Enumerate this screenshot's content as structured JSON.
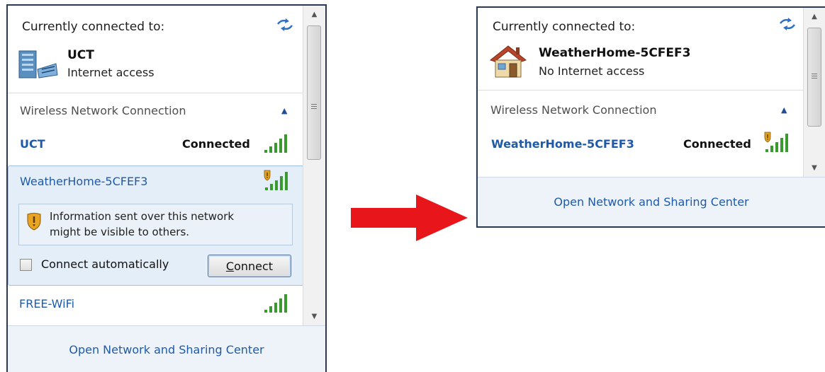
{
  "before": {
    "heading": "Currently connected to:",
    "current": {
      "name": "UCT",
      "status": "Internet access",
      "icon": "network-building-icon"
    },
    "section_title": "Wireless Network Connection",
    "networks": [
      {
        "name": "UCT",
        "state": "Connected",
        "secured": true
      },
      {
        "name": "WeatherHome-5CFEF3",
        "state": "",
        "secured": false
      },
      {
        "name": "FREE-WiFi",
        "state": "",
        "secured": false
      }
    ],
    "warning": {
      "line1": "Information sent over this network",
      "line2": "might be visible to others."
    },
    "connect_auto_label": "Connect automatically",
    "connect_auto_checked": false,
    "connect_button": {
      "accel": "C",
      "rest": "onnect"
    },
    "footer_link": "Open Network and Sharing Center"
  },
  "after": {
    "heading": "Currently connected to:",
    "current": {
      "name": "WeatherHome-5CFEF3",
      "status": "No Internet access",
      "icon": "house-icon"
    },
    "section_title": "Wireless Network Connection",
    "networks": [
      {
        "name": "WeatherHome-5CFEF3",
        "state": "Connected",
        "secured": false
      }
    ],
    "footer_link": "Open Network and Sharing Center"
  },
  "colors": {
    "link": "#1e5aa8",
    "arrow": "#e8161b",
    "signal": "#3a9a2f",
    "shield": "#e0a020"
  }
}
